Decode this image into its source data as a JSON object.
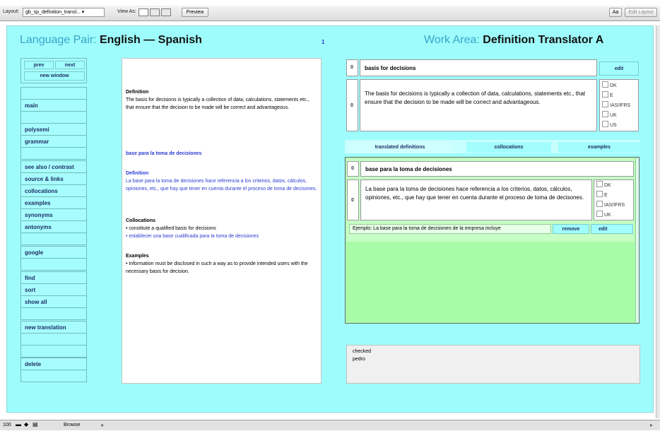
{
  "toolbar": {
    "layout_label": "Layout:",
    "layout_value": "gb_sp_definition_transl... ▾",
    "view_as_label": "View As:",
    "preview_button": "Preview",
    "aa_button": "Aa",
    "edit_layout_button": "Edit Layout"
  },
  "header": {
    "language_pair_label": "Language Pair:",
    "language_pair_value": "English — Spanish",
    "record_count": "1",
    "work_area_label": "Work Area:",
    "work_area_value": "Definition Translator A"
  },
  "sidebar": {
    "prev": "prev",
    "next": "next",
    "new_window": "new window",
    "main": "main",
    "polysemi": "polysemi",
    "grammar": "grammar",
    "see_also": "see also / contrast",
    "source_links": "source & links",
    "collocations": "collocations",
    "examples": "examples",
    "synonyms": "synonyms",
    "antonyms": "antonyms",
    "google": "google",
    "find": "find",
    "sort": "sort",
    "show_all": "show all",
    "new_translation": "new translation",
    "delete": "delete"
  },
  "document": {
    "def_heading": "Definition",
    "def_text": "The basis for decisions is typically a collection of data, calculations, statements etc., that ensure that the decision to be made will be correct and advantageous.",
    "es_term": "base para la toma de decisiones",
    "es_def_heading": "Definition",
    "es_def_text": "La base para la toma de decisiones hace referencia a los criterios, datos, cálculos, opiniones, etc., que hay que tener en cuenta durante el proceso de toma de decisones.",
    "coll_heading": "Collocations",
    "coll_en": "• constitute a qualified basis for decisions",
    "coll_es": "• establecer una base cualificada para la toma de decisiones",
    "ex_heading": "Examples",
    "ex_text": "• Information must be disclosed in such a way as to provide intended users with the necessary basis for decision."
  },
  "source_entry": {
    "term_number": "0",
    "term": "basis for decisions",
    "edit_button": "edit",
    "def_number": "0",
    "definition": "The basis for decisions is typically a collection of data, calculations, statements etc., that ensure that the decision to be made will be correct and advantageous.",
    "regions": [
      "DK",
      "E",
      "IAS/IFRS",
      "UK",
      "US"
    ]
  },
  "tabs": {
    "translated_definitions": "translated definitions",
    "collocations": "collocations",
    "examples": "examples"
  },
  "translated": {
    "term_number": "0",
    "term": "base para la toma de decisiones",
    "def_number": "0",
    "definition": "La base para la toma de decisiones hace referencia a los criterios, datos, cálculos, opiniones, etc., que hay que tener en cuenta durante el proceso de toma de decisones.",
    "regions": [
      "DK",
      "E",
      "IAS/IFRS",
      "UK"
    ],
    "example": "Ejemplo: La base para la toma de decisiones de la empresa incluye",
    "remove_button": "remove",
    "edit_button": "edit"
  },
  "notes": {
    "line1": "checked",
    "line2": "pedro"
  },
  "statusbar": {
    "zoom": "100",
    "mode": "Browse"
  },
  "colors": {
    "canvas": "#9ffcfc",
    "header_label": "#36a6c8",
    "translation_blue": "#2a3bd0",
    "panel_green": "#a8fca8"
  }
}
